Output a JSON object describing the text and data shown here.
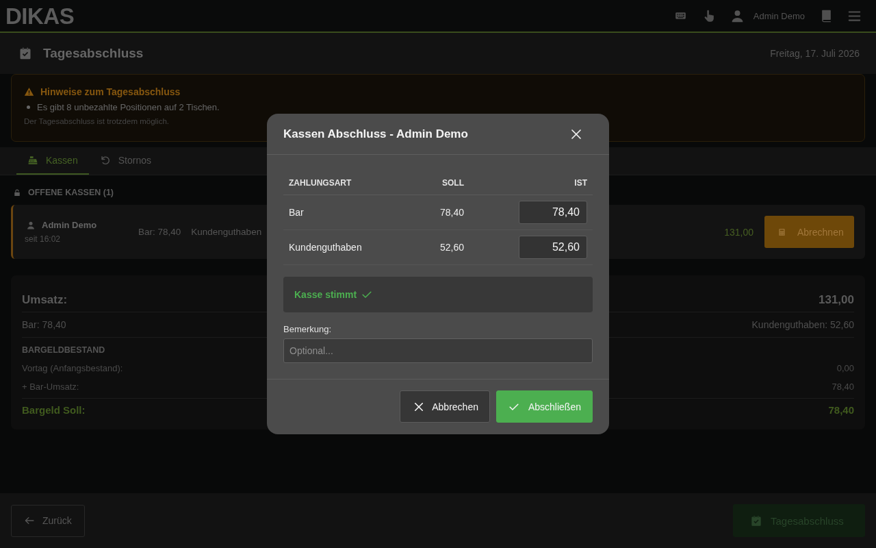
{
  "header": {
    "logo": "DIKAS",
    "user_name": "Admin Demo"
  },
  "page": {
    "title": "Tagesabschluss",
    "date": "Freitag, 17. Juli 2026"
  },
  "notice": {
    "title": "Hinweise zum Tagesabschluss",
    "items": [
      "Es gibt 8 unbezahlte Positionen auf 2 Tischen."
    ],
    "note": "Der Tagesabschluss ist trotzdem möglich."
  },
  "tabs": [
    {
      "label": "Kassen",
      "kind": "register",
      "selected": true
    },
    {
      "label": "Stornos",
      "kind": "undo",
      "selected": false
    }
  ],
  "open_registers": {
    "heading": "OFFENE KASSEN (1)",
    "items": [
      {
        "user": "Admin Demo",
        "since": "seit 16:02",
        "amounts": [
          "Bar: 78,40",
          "Kundenguthaben"
        ],
        "total": "131,00",
        "action": "Abrechnen"
      }
    ]
  },
  "summary": {
    "title": "Umsatz:",
    "total": "131,00",
    "left_breakdown": "Bar: 78,40",
    "right_breakdown": "Kundenguthaben: 52,60",
    "cash_heading": "BARGELDBESTAND",
    "cash_rows": [
      {
        "label": "Vortag (Anfangsbestand):",
        "value": "0,00"
      },
      {
        "label": "+ Bar-Umsatz:",
        "value": "78,40"
      }
    ],
    "cash_total": {
      "label": "Bargeld Soll:",
      "value": "78,40"
    }
  },
  "footer": {
    "back": "Zurück",
    "submit": {
      "label": "Tagesabschluss",
      "disabled": true
    }
  },
  "dialog": {
    "title": "Kassen Abschluss - Admin Demo",
    "columns": [
      "ZAHLUNGSART",
      "SOLL",
      "IST"
    ],
    "rows": [
      {
        "method": "Bar",
        "expected": "78,40",
        "actual": "78,40"
      },
      {
        "method": "Kundenguthaben",
        "expected": "52,60",
        "actual": "52,60"
      }
    ],
    "status": {
      "kind": "ok",
      "text": "Kasse stimmt"
    },
    "remark": {
      "label": "Bemerkung:",
      "placeholder": "Optional..."
    },
    "buttons": [
      {
        "label": "Abbrechen",
        "kind": "cancel"
      },
      {
        "label": "Abschließen",
        "kind": "confirm"
      }
    ]
  }
}
